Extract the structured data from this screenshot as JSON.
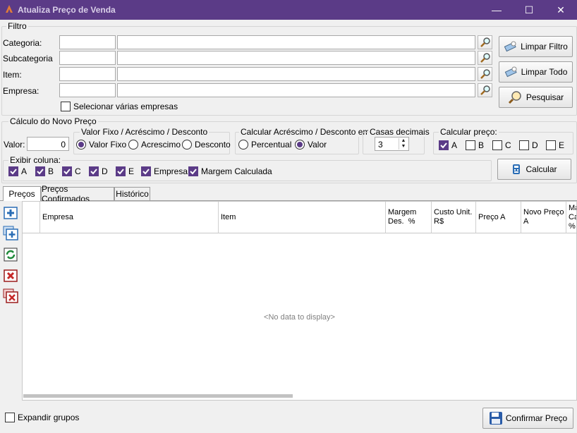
{
  "window": {
    "title": "Atualiza Preço de Venda",
    "minimize": "—",
    "maximize": "☐",
    "close": "✕"
  },
  "filtro": {
    "legend": "Filtro",
    "categoria_label": "Categoria:",
    "subcategoria_label": "Subcategoria",
    "item_label": "Item:",
    "empresa_label": "Empresa:",
    "categoria_code": "",
    "categoria_desc": "",
    "subcategoria_code": "",
    "subcategoria_desc": "",
    "item_code": "",
    "item_desc": "",
    "empresa_code": "",
    "empresa_desc": "",
    "varias_empresas_label": "Selecionar várias empresas",
    "limpar_filtro": "Limpar Filtro",
    "limpar_todo": "Limpar Todo",
    "pesquisar": "Pesquisar"
  },
  "calculo": {
    "legend": "Cálculo do Novo Preço",
    "valor_label": "Valor:",
    "valor": "0",
    "tipo_legend": "Valor Fixo / Acréscimo / Desconto",
    "tipo_options": [
      "Valor Fixo",
      "Acrescimo",
      "Desconto"
    ],
    "em_legend": "Calcular Acréscimo / Desconto em:",
    "em_options": [
      "Percentual",
      "Valor"
    ],
    "casas_legend": "Casas decimais",
    "casas": "3",
    "calc_preco_legend": "Calcular preço:",
    "calc_preco": [
      "A",
      "B",
      "C",
      "D",
      "E"
    ],
    "exibir_legend": "Exibir coluna:",
    "exibir": [
      "A",
      "B",
      "C",
      "D",
      "E",
      "Empresa",
      "Margem Calculada"
    ],
    "calcular": "Calcular"
  },
  "tabs": [
    "Preços",
    "Preços Confirmados",
    "Histórico"
  ],
  "grid": {
    "columns": [
      "Empresa",
      "Item",
      "Margem\nDes.  %",
      "Custo Unit.\nR$",
      "Preço A",
      "Novo Preço\nA",
      "Ma\nCa\n%"
    ],
    "empty_text": "<No data to display>"
  },
  "footer": {
    "expandir_label": "Expandir grupos",
    "confirmar": "Confirmar Preço"
  },
  "colors": {
    "accent": "#5b3b87"
  }
}
